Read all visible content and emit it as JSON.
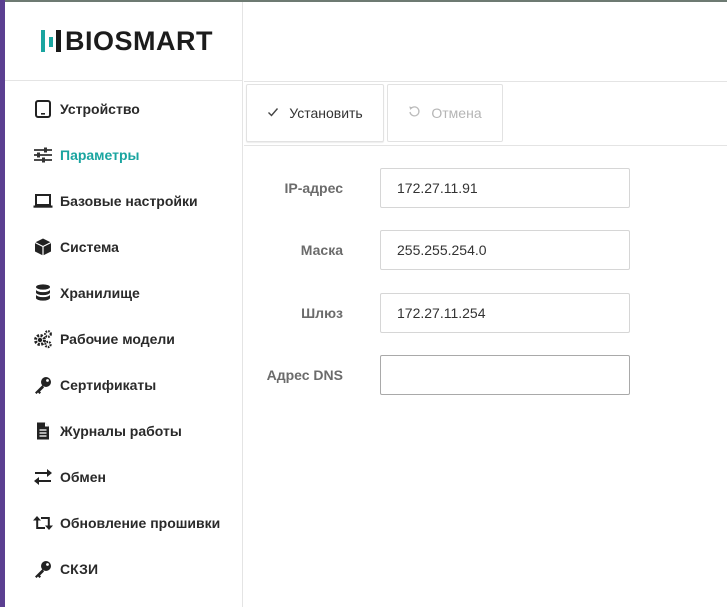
{
  "brand": {
    "logo_text": "BIOSMART",
    "accent": "#1aa5a0"
  },
  "sidebar": {
    "items": [
      {
        "label": "Устройство",
        "icon": "tablet-icon",
        "active": false
      },
      {
        "label": "Параметры",
        "icon": "sliders-icon",
        "active": true
      },
      {
        "label": "Базовые настройки",
        "icon": "laptop-icon",
        "active": false
      },
      {
        "label": "Система",
        "icon": "cube-icon",
        "active": false
      },
      {
        "label": "Хранилище",
        "icon": "database-icon",
        "active": false
      },
      {
        "label": "Рабочие модели",
        "icon": "gears-icon",
        "active": false
      },
      {
        "label": "Сертификаты",
        "icon": "key-icon",
        "active": false
      },
      {
        "label": "Журналы работы",
        "icon": "file-text-icon",
        "active": false
      },
      {
        "label": "Обмен",
        "icon": "exchange-icon",
        "active": false
      },
      {
        "label": "Обновление прошивки",
        "icon": "retweet-icon",
        "active": false
      },
      {
        "label": "СКЗИ",
        "icon": "key-icon",
        "active": false
      }
    ]
  },
  "toolbar": {
    "apply_label": "Установить",
    "apply_icon": "check-icon",
    "cancel_label": "Отмена",
    "cancel_icon": "undo-icon"
  },
  "form": {
    "fields": [
      {
        "label": "IP-адрес",
        "value": "172.27.11.91"
      },
      {
        "label": "Маска",
        "value": "255.255.254.0"
      },
      {
        "label": "Шлюз",
        "value": "172.27.11.254"
      },
      {
        "label": "Адрес DNS",
        "value": ""
      }
    ]
  }
}
